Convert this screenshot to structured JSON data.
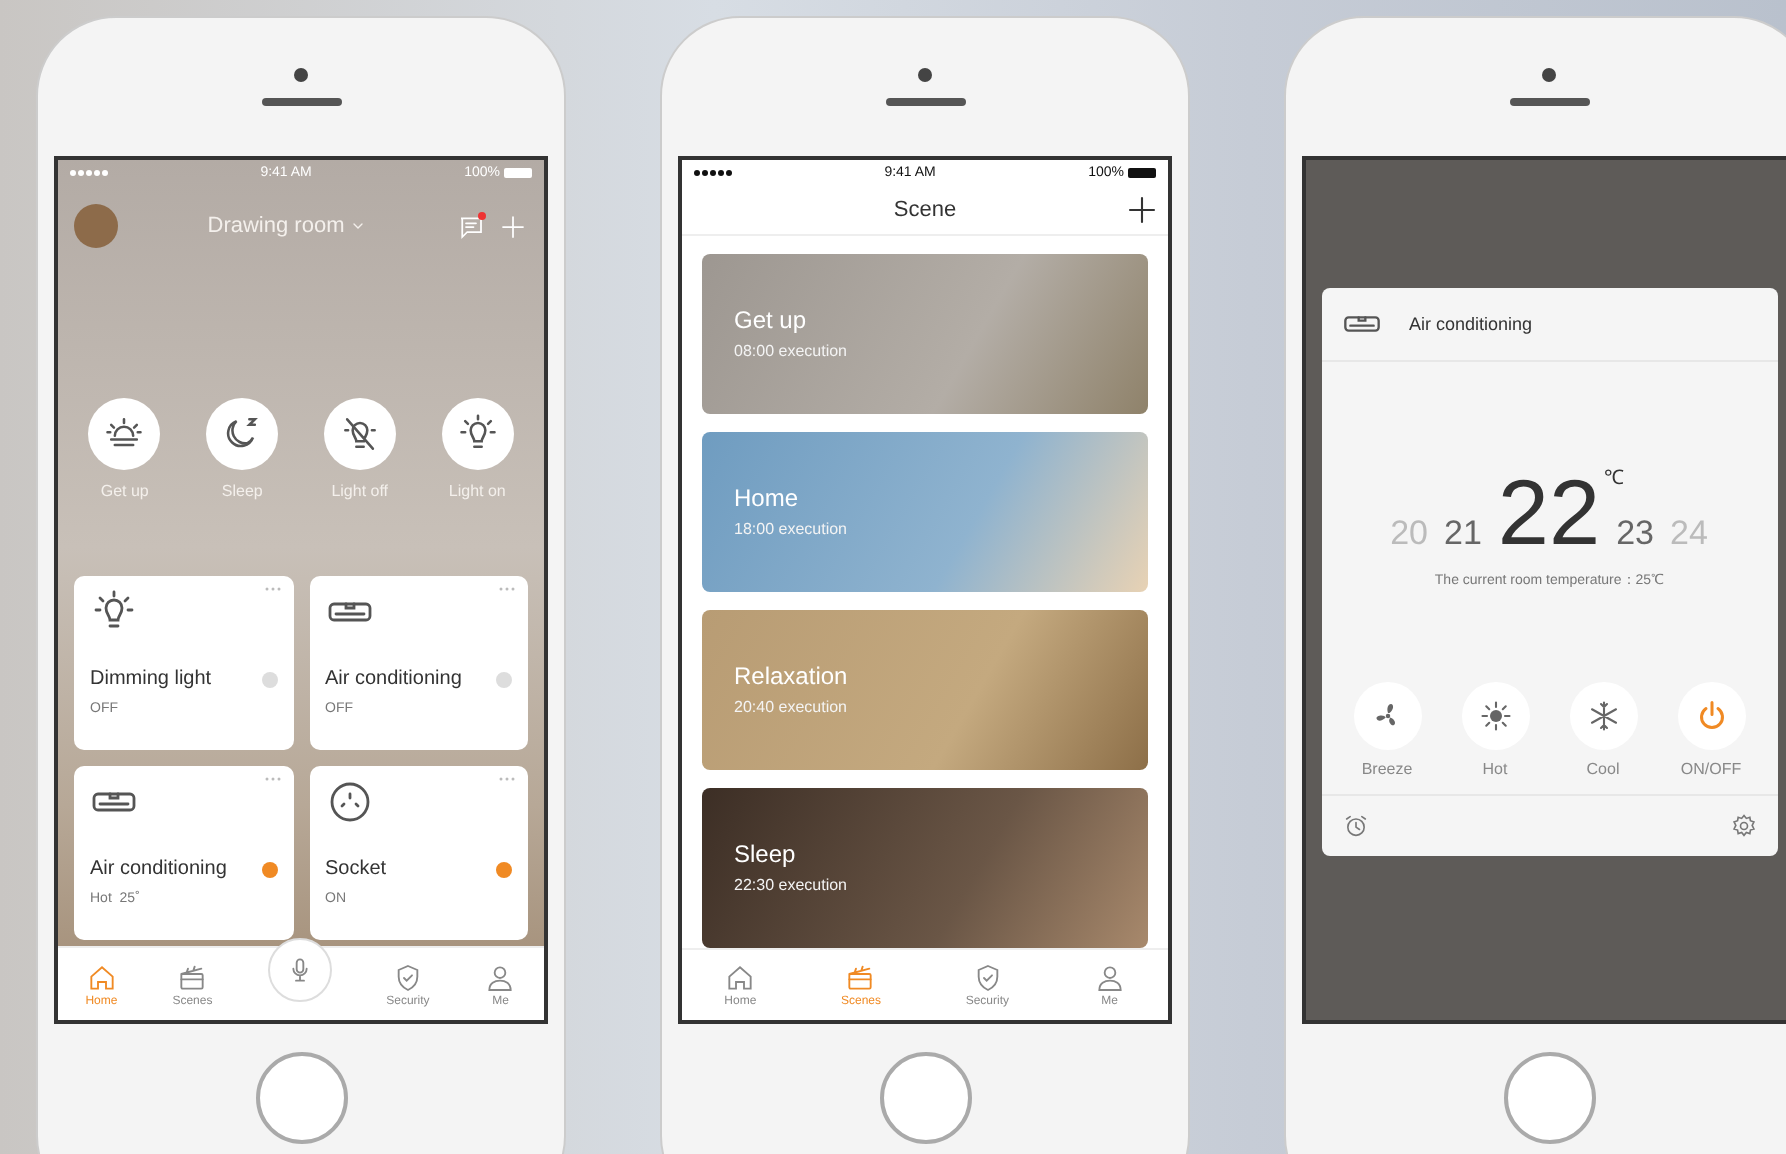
{
  "home": {
    "status": {
      "time": "9:41 AM",
      "battery": "100%"
    },
    "room": "Drawing room",
    "unread": true,
    "quick_scenes": [
      {
        "label": "Get up",
        "kind": "sunrise"
      },
      {
        "label": "Sleep",
        "kind": "moon"
      },
      {
        "label": "Light off",
        "kind": "lightoff"
      },
      {
        "label": "Light on",
        "kind": "lighton"
      }
    ],
    "devices": [
      {
        "name": "Dimming light",
        "status": "OFF",
        "on": false,
        "kind": "light"
      },
      {
        "name": "Air conditioning",
        "status": "OFF",
        "on": false,
        "kind": "ac"
      },
      {
        "name": "Air conditioning",
        "status": "Hot  25˚",
        "on": true,
        "kind": "ac"
      },
      {
        "name": "Socket",
        "status": "ON",
        "on": true,
        "kind": "socket"
      }
    ],
    "nav": [
      {
        "label": "Home",
        "kind": "home",
        "selected": true
      },
      {
        "label": "Scenes",
        "kind": "scenes",
        "selected": false
      },
      {
        "kind": "voice",
        "selected": false
      },
      {
        "label": "Security",
        "kind": "security",
        "selected": false
      },
      {
        "label": "Me",
        "kind": "me",
        "selected": false
      }
    ]
  },
  "scenes": {
    "status": {
      "time": "9:41 AM",
      "battery": "100%"
    },
    "title": "Scene",
    "items": [
      {
        "title": "Get up",
        "subtitle": "08:00 execution"
      },
      {
        "title": "Home",
        "subtitle": "18:00 execution"
      },
      {
        "title": "Relaxation",
        "subtitle": "20:40 execution"
      },
      {
        "title": "Sleep",
        "subtitle": "22:30 execution"
      }
    ],
    "nav": [
      {
        "label": "Home",
        "kind": "home",
        "selected": false
      },
      {
        "label": "Scenes",
        "kind": "scenes",
        "selected": true
      },
      {
        "label": "Security",
        "kind": "security",
        "selected": false
      },
      {
        "label": "Me",
        "kind": "me",
        "selected": false
      }
    ]
  },
  "ac": {
    "title": "Air conditioning",
    "unit": "℃",
    "temperatures": [
      {
        "value": "20",
        "selected": false
      },
      {
        "value": "21",
        "selected": false
      },
      {
        "value": "22",
        "selected": true
      },
      {
        "value": "23",
        "selected": false
      },
      {
        "value": "24",
        "selected": false
      }
    ],
    "current": "The current room temperature：25℃",
    "modes": [
      {
        "label": "Breeze",
        "kind": "breeze",
        "on": false
      },
      {
        "label": "Hot",
        "kind": "hot",
        "on": false
      },
      {
        "label": "Cool",
        "kind": "cool",
        "on": false
      },
      {
        "label": "ON/OFF",
        "kind": "power",
        "on": true
      }
    ]
  }
}
